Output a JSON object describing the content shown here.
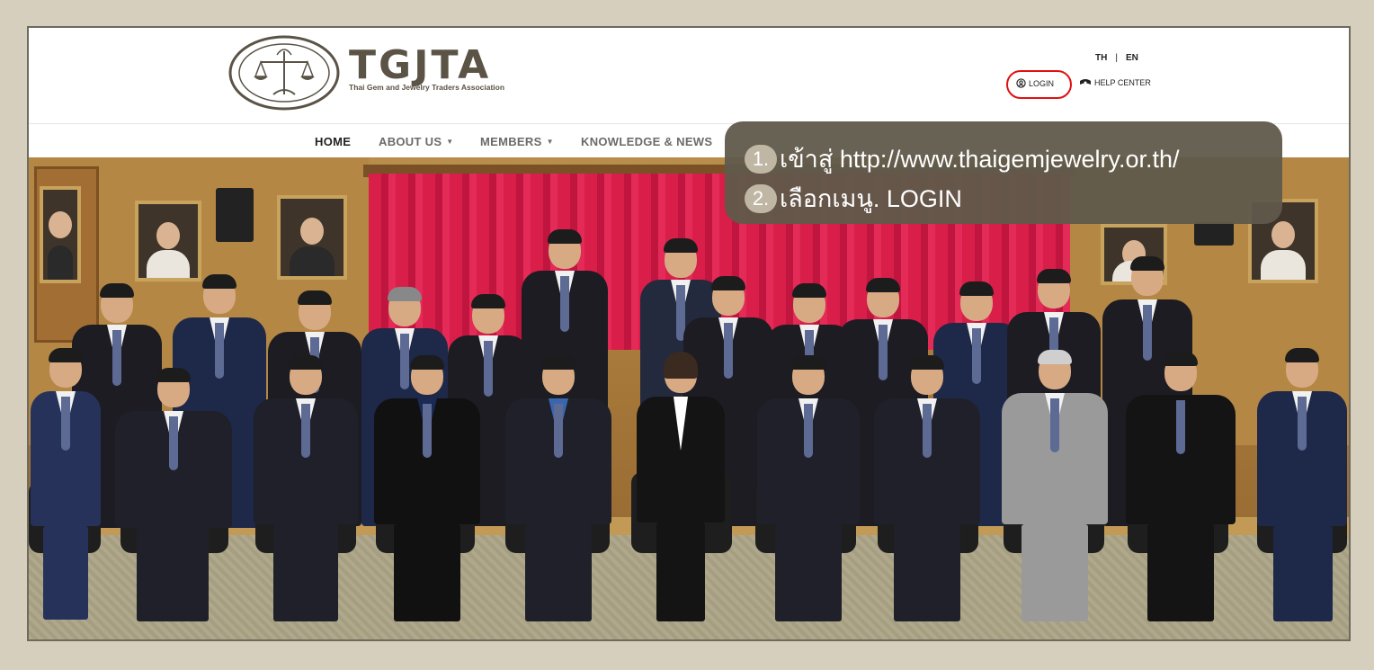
{
  "header": {
    "brand_name": "TGJTA",
    "brand_subtitle": "Thai Gem and Jewelry Traders Association",
    "lang_th": "TH",
    "lang_sep": "|",
    "lang_en": "EN",
    "login_label": "LOGIN",
    "help_label": "HELP CENTER"
  },
  "nav": {
    "items": [
      {
        "label": "HOME",
        "active": true
      },
      {
        "label": "ABOUT US",
        "dropdown": true
      },
      {
        "label": "MEMBERS",
        "dropdown": true
      },
      {
        "label": "KNOWLEDGE & NEWS"
      }
    ]
  },
  "callout": {
    "steps": [
      {
        "num": "1.",
        "text": "เข้าสู่ http://www.thaigemjewelry.or.th/"
      },
      {
        "num": "2.",
        "text": "เลือกเมนู. LOGIN"
      }
    ]
  },
  "colors": {
    "background": "#d6cfbd",
    "brand": "#5a5346",
    "highlight_ring": "#e01010",
    "callout_bg": "#605a4b",
    "curtain": "#d81e49"
  },
  "icons": [
    "user-circle-icon",
    "help-headset-icon",
    "caret-down-icon",
    "association-seal-logo"
  ]
}
